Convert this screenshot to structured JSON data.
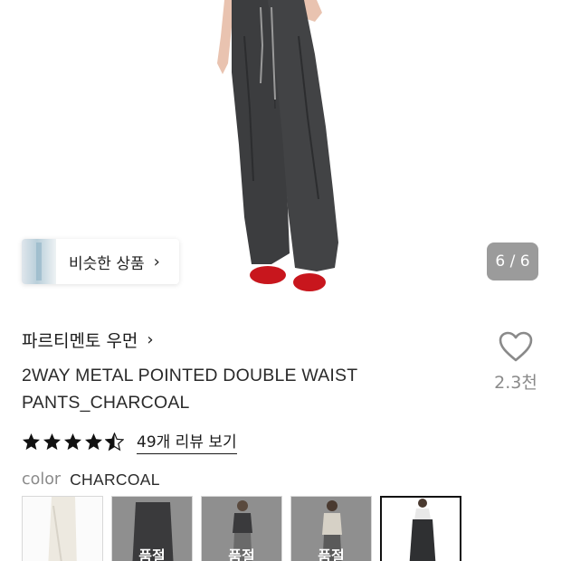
{
  "gallery": {
    "counter": "6 / 6",
    "similar_label": "비슷한 상품"
  },
  "product": {
    "brand": "파르티멘토 우먼",
    "title_line1": "2WAY METAL POINTED DOUBLE WAIST",
    "title_line2": "PANTS_CHARCOAL",
    "like_count": "2.3천",
    "rating": 4.5,
    "review_link": "49개 리뷰 보기",
    "color_key": "color",
    "color_value": "CHARCOAL"
  },
  "swatches": [
    {
      "name": "ivory",
      "soldout": "",
      "selected": false
    },
    {
      "name": "charcoal-flat",
      "soldout": "품절",
      "selected": false
    },
    {
      "name": "model-vest",
      "soldout": "품절",
      "selected": false
    },
    {
      "name": "model-beige",
      "soldout": "품절",
      "selected": false
    },
    {
      "name": "model-charcoal",
      "soldout": "",
      "selected": true
    }
  ],
  "colors": {
    "star": "#111111",
    "heart": "#8a8a8a",
    "pants": "#3c3d3f",
    "shoe": "#c8161d"
  }
}
